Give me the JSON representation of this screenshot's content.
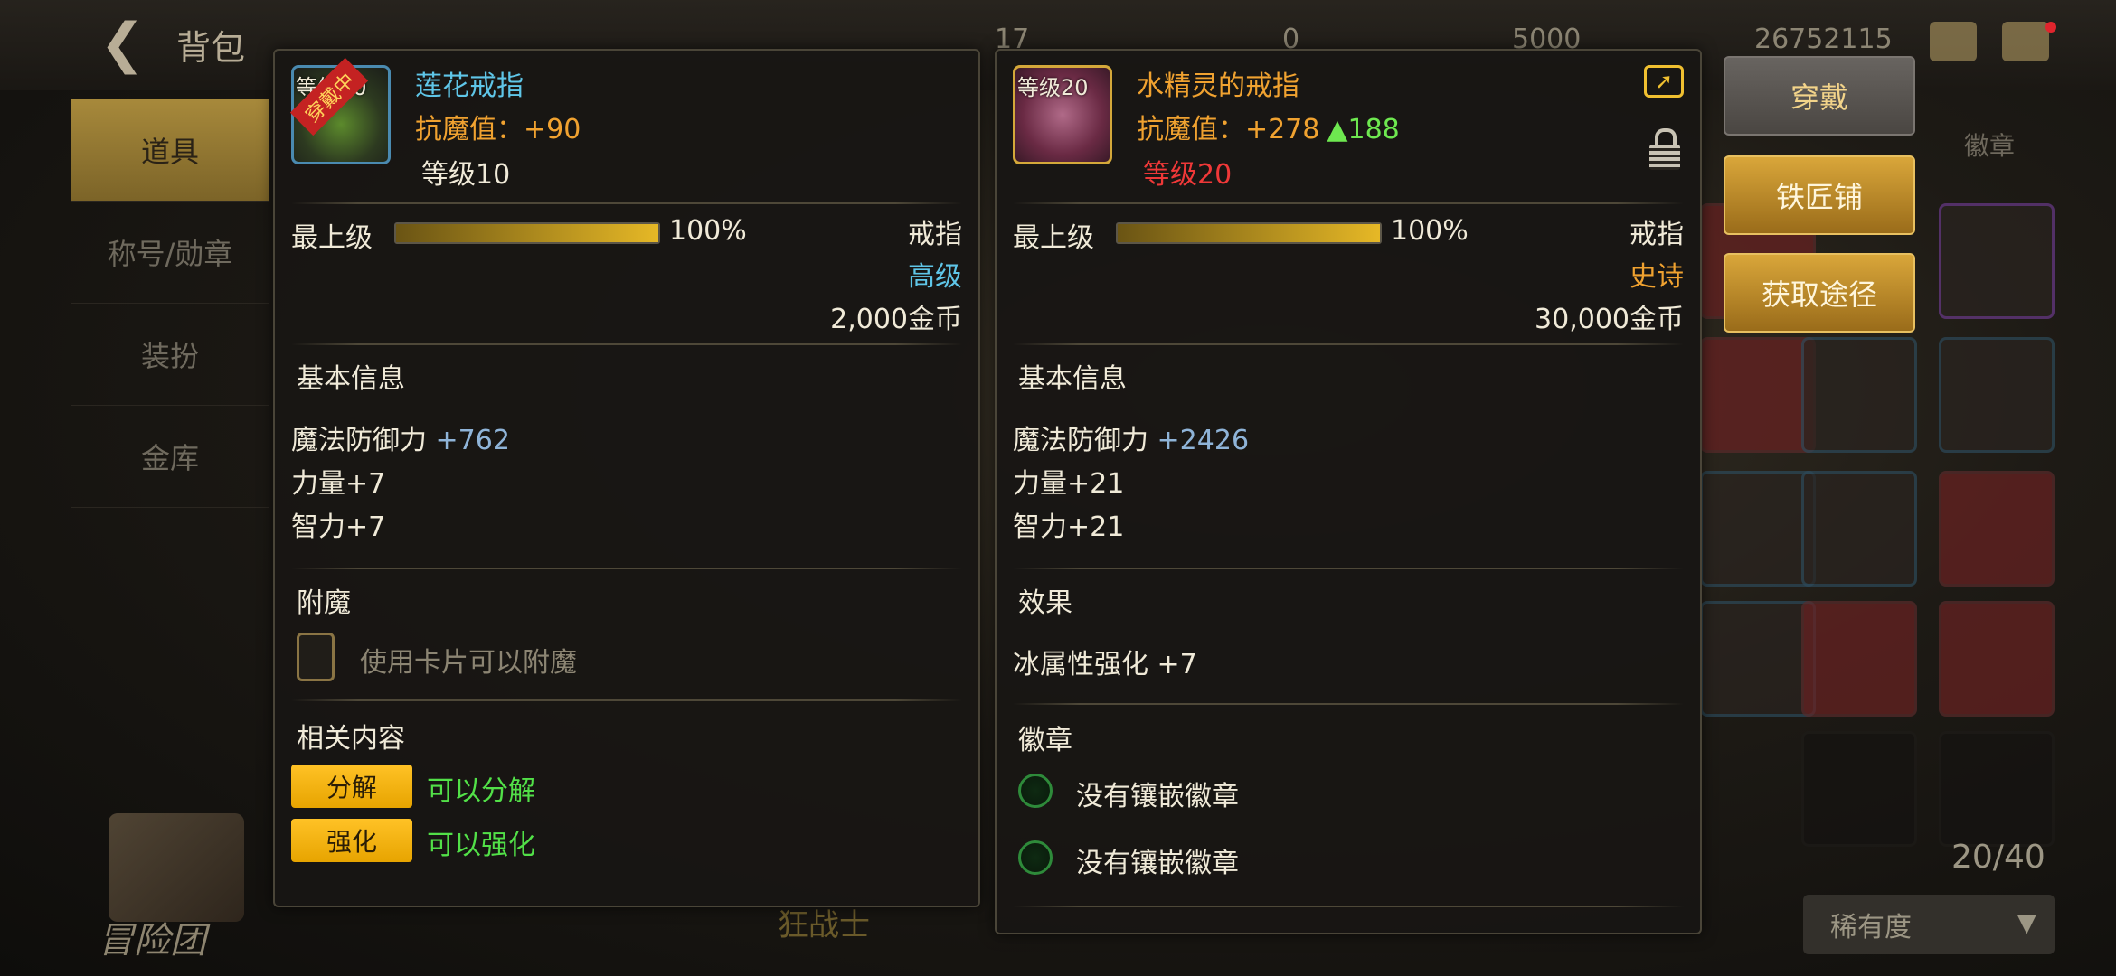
{
  "header": {
    "title": "背包",
    "currencies": [
      "17",
      "0",
      "5000",
      "26752115"
    ]
  },
  "sidebar": {
    "items": [
      {
        "label": "道具"
      },
      {
        "label": "称号/勋章"
      },
      {
        "label": "装扮"
      },
      {
        "label": "金库"
      }
    ]
  },
  "inventory": {
    "tab_hint": "徽章",
    "count": "20/40",
    "sort_label": "稀有度",
    "character": "狂战士",
    "book_label": "冒险团"
  },
  "left_panel": {
    "level_tag": "等级10",
    "equipped_ribbon": "穿戴中",
    "name": "莲花戒指",
    "resist": "抗魔值：+90",
    "level": "等级10",
    "max_level_label": "最上级",
    "max_level_progress": 1.0,
    "percent": "100%",
    "item_type": "戒指",
    "grade": "高级",
    "price": "2,000金币",
    "basic_info_title": "基本信息",
    "stat_magic_def_label": "魔法防御力",
    "stat_magic_def_value": "+762",
    "stat_str": "力量+7",
    "stat_int": "智力+7",
    "enchant_title": "附魔",
    "enchant_text": "使用卡片可以附魔",
    "related_title": "相关内容",
    "decompose_btn": "分解",
    "decompose_text": "可以分解",
    "enhance_btn": "强化",
    "enhance_text": "可以强化"
  },
  "right_panel": {
    "level_tag": "等级20",
    "name": "水精灵的戒指",
    "resist": "抗魔值：+278",
    "resist_up": "▲188",
    "level": "等级20",
    "max_level_label": "最上级",
    "max_level_progress": 1.0,
    "percent": "100%",
    "item_type": "戒指",
    "grade": "史诗",
    "price": "30,000金币",
    "basic_info_title": "基本信息",
    "stat_magic_def_label": "魔法防御力",
    "stat_magic_def_value": "+2426",
    "stat_str": "力量+21",
    "stat_int": "智力+21",
    "effect_title": "效果",
    "effect_text": "冰属性强化 +7",
    "badge_title": "徽章",
    "badge_slot_1": "没有镶嵌徽章",
    "badge_slot_2": "没有镶嵌徽章"
  },
  "actions": {
    "wear": "穿戴",
    "blacksmith": "铁匠铺",
    "obtain": "获取途径"
  },
  "icons": {
    "back": "back-arrow-icon",
    "share": "share-icon",
    "lock": "lock-icon",
    "mail": "mail-icon",
    "chat": "chat-icon"
  },
  "colors": {
    "grade_high": "#5fc6e8",
    "grade_epic": "#f0a230",
    "positive": "#52e048",
    "action_gold": "#d9a63a"
  }
}
